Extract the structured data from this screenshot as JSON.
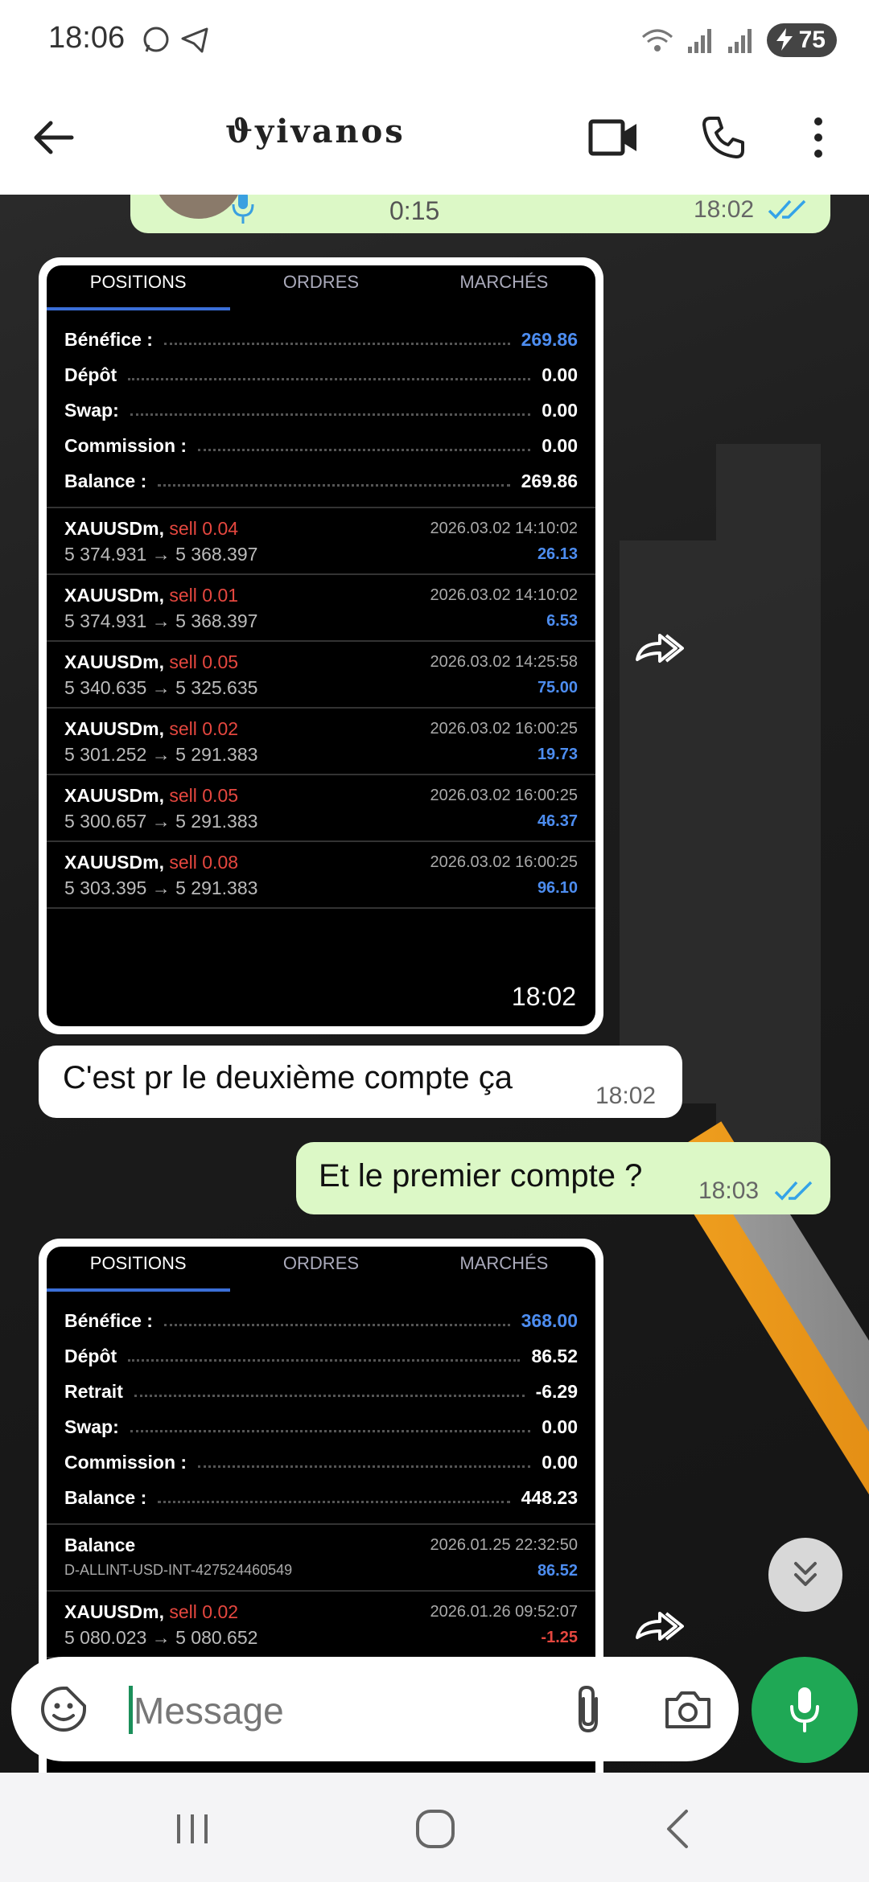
{
  "status_bar": {
    "time": "18:06",
    "battery": "75"
  },
  "header": {
    "contact_name": "ϑyivanos"
  },
  "messages": {
    "voice": {
      "duration": "0:15",
      "time": "18:02"
    },
    "incoming_text": {
      "text": "C'est pr le deuxième compte ça",
      "time": "18:02"
    },
    "outgoing_text": {
      "text": "Et le premier compte ?",
      "time": "18:03"
    }
  },
  "screenshot1": {
    "tabs": [
      "POSITIONS",
      "ORDRES",
      "MARCHÉS"
    ],
    "summary": [
      {
        "label": "Bénéfice :",
        "value": "269.86"
      },
      {
        "label": "Dépôt",
        "value": "0.00"
      },
      {
        "label": "Swap:",
        "value": "0.00"
      },
      {
        "label": "Commission :",
        "value": "0.00"
      },
      {
        "label": "Balance :",
        "value": "269.86"
      }
    ],
    "trades": [
      {
        "symbol": "XAUUSDm,",
        "side": "sell 0.04",
        "prices": "5 374.931 → 5 368.397",
        "time": "2026.03.02 14:10:02",
        "pl": "26.13"
      },
      {
        "symbol": "XAUUSDm,",
        "side": "sell 0.01",
        "prices": "5 374.931 → 5 368.397",
        "time": "2026.03.02 14:10:02",
        "pl": "6.53"
      },
      {
        "symbol": "XAUUSDm,",
        "side": "sell 0.05",
        "prices": "5 340.635 → 5 325.635",
        "time": "2026.03.02 14:25:58",
        "pl": "75.00"
      },
      {
        "symbol": "XAUUSDm,",
        "side": "sell 0.02",
        "prices": "5 301.252 → 5 291.383",
        "time": "2026.03.02 16:00:25",
        "pl": "19.73"
      },
      {
        "symbol": "XAUUSDm,",
        "side": "sell 0.05",
        "prices": "5 300.657 → 5 291.383",
        "time": "2026.03.02 16:00:25",
        "pl": "46.37"
      },
      {
        "symbol": "XAUUSDm,",
        "side": "sell 0.08",
        "prices": "5 303.395 → 5 291.383",
        "time": "2026.03.02 16:00:25",
        "pl": "96.10"
      }
    ],
    "time": "18:02"
  },
  "screenshot2": {
    "tabs": [
      "POSITIONS",
      "ORDRES",
      "MARCHÉS"
    ],
    "summary": [
      {
        "label": "Bénéfice :",
        "value": "368.00"
      },
      {
        "label": "Dépôt",
        "value": "86.52"
      },
      {
        "label": "Retrait",
        "value": "-6.29"
      },
      {
        "label": "Swap:",
        "value": "0.00"
      },
      {
        "label": "Commission :",
        "value": "0.00"
      },
      {
        "label": "Balance :",
        "value": "448.23"
      }
    ],
    "balance_entry": {
      "title": "Balance",
      "sub": "D-ALLINT-USD-INT-427524460549",
      "time": "2026.01.25 22:32:50",
      "pl": "86.52"
    },
    "trade": {
      "symbol": "XAUUSDm,",
      "side": "sell 0.02",
      "prices": "5 080.023 → 5 080.652",
      "time": "2026.01.26 09:52:07",
      "pl": "-1.25"
    }
  },
  "composer": {
    "placeholder": "Message"
  },
  "colors": {
    "outgoing_bubble": "#dcf8c6",
    "mic_button": "#1fa855",
    "profit_blue": "#4d8df0",
    "sell_red": "#e5473f"
  }
}
